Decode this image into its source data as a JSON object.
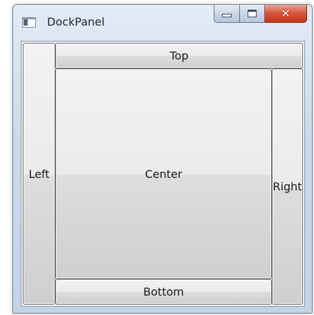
{
  "window": {
    "title": "DockPanel",
    "icon": "window-app-icon",
    "caption_buttons": {
      "minimize_icon": "minimize-icon",
      "maximize_icon": "maximize-icon",
      "close_icon": "close-icon",
      "close_glyph": "✕",
      "close_color": "#d4543a"
    }
  },
  "dock_panel": {
    "left_label": "Left",
    "top_label": "Top",
    "right_label": "Right",
    "bottom_label": "Bottom",
    "center_label": "Center"
  }
}
